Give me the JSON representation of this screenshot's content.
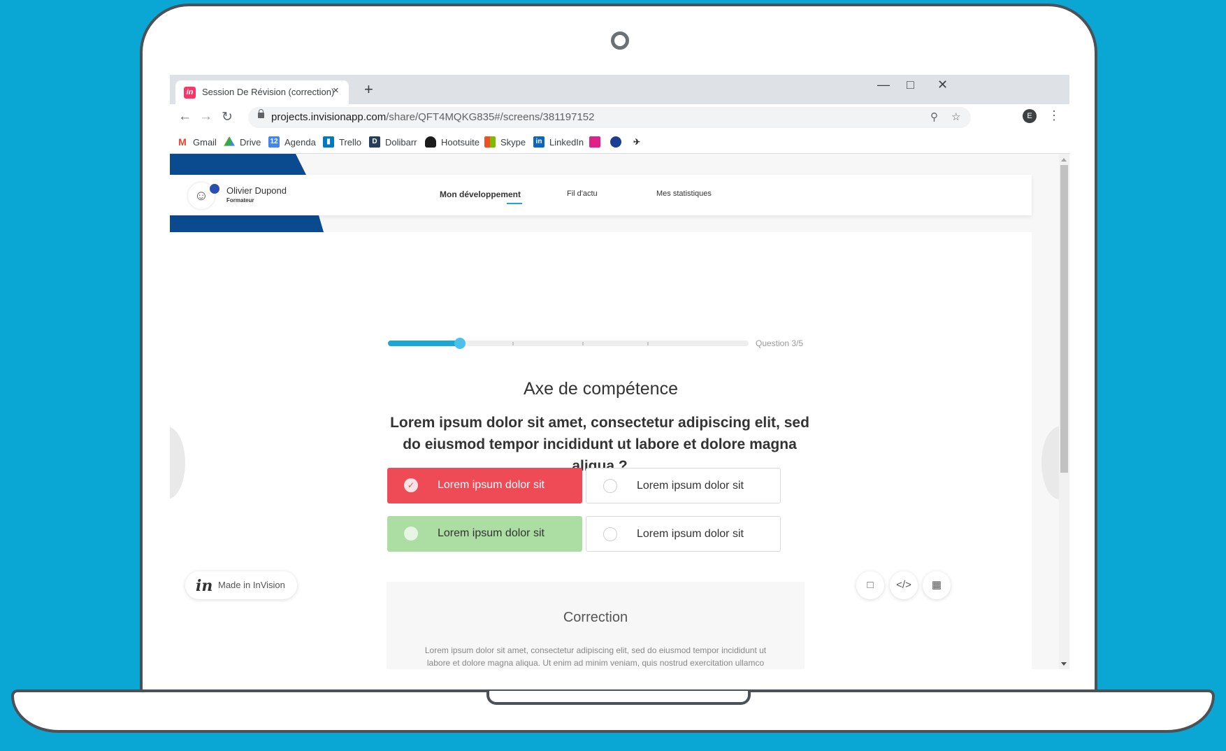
{
  "browser": {
    "tab_title": "Session De Révision (correction)",
    "tab_close": "×",
    "new_tab": "+",
    "url_host": "projects.invisionapp.com",
    "url_path": "/share/QFT4MQKG835#/screens/381197152",
    "profile_initial": "E",
    "bookmarks": [
      {
        "label": "Gmail",
        "icon": "gmail-icon",
        "color": "#ea4335"
      },
      {
        "label": "Drive",
        "icon": "drive-icon",
        "color": "#34a853"
      },
      {
        "label": "Agenda",
        "icon": "calendar-icon",
        "color": "#4285f4"
      },
      {
        "label": "Trello",
        "icon": "trello-icon",
        "color": "#0079bf"
      },
      {
        "label": "Dolibarr",
        "icon": "dolibarr-icon",
        "color": "#263c5c"
      },
      {
        "label": "Hootsuite",
        "icon": "hootsuite-icon",
        "color": "#1c1c1c"
      },
      {
        "label": "Skype",
        "icon": "skype-icon",
        "color": "#00aff0"
      },
      {
        "label": "LinkedIn",
        "icon": "linkedin-icon",
        "color": "#0a66c2"
      }
    ]
  },
  "app": {
    "user_name": "Olivier Dupond",
    "user_role": "Formateur",
    "nav": [
      "Mon développement",
      "Fil d'actu",
      "Mes statistiques"
    ],
    "progress_label": "Question 3/5",
    "progress_fraction": 0.2,
    "question_title": "Axe de compétence",
    "question_text": "Lorem ipsum dolor sit amet, consectetur adipiscing elit, sed do eiusmod tempor incididunt ut labore et dolore magna aliqua ?",
    "answers": [
      {
        "label": "Lorem ipsum dolor sit",
        "state": "wrong-selected"
      },
      {
        "label": "Lorem ipsum dolor sit",
        "state": "unselected"
      },
      {
        "label": "Lorem ipsum dolor sit",
        "state": "correct"
      },
      {
        "label": "Lorem ipsum dolor sit",
        "state": "unselected"
      }
    ],
    "correction_title": "Correction",
    "correction_text": "Lorem ipsum dolor sit amet, consectetur adipiscing elit, sed do eiusmod tempor incididunt ut labore et dolore magna aliqua. Ut enim ad minim veniam, quis nostrud exercitation ullamco laboris nisi ut aliquip ex ea commodo consequat. Duis aute irure dolor in reprehenderit in voluptate velit esse cillum dolore eu fugiat nulla pariatur.",
    "invision_logo": "in",
    "invision_badge": "Made in InVision",
    "colors": {
      "accent": "#1ba7d6",
      "wrong": "#ef4b57",
      "correct": "#acdea3",
      "brand_blue": "#0a4a8f"
    }
  }
}
